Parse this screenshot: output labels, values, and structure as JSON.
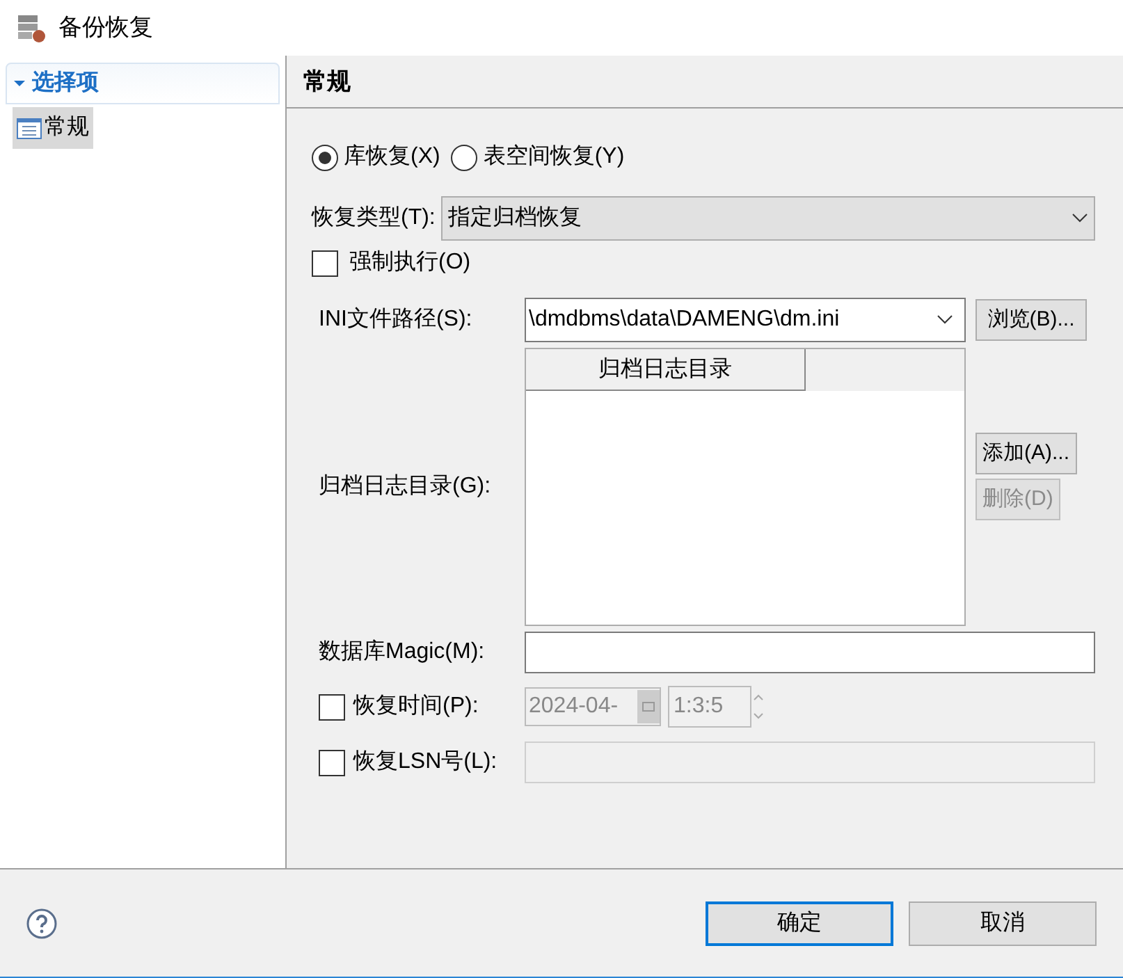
{
  "window": {
    "title": "备份恢复"
  },
  "sidebar": {
    "header": "选择项",
    "expanded": true,
    "items": [
      {
        "label": "常规",
        "selected": true
      }
    ]
  },
  "panel": {
    "title": "常规"
  },
  "restore_mode": [
    {
      "label": "库恢复(X)",
      "selected": true
    },
    {
      "label": "表空间恢复(Y)",
      "selected": false
    }
  ],
  "restore_type": {
    "label": "恢复类型(T):",
    "value": "指定归档恢复"
  },
  "force": {
    "label": "强制执行(O)",
    "checked": false
  },
  "ini_path": {
    "label": "INI文件路径(S):",
    "value": "\\dmdbms\\data\\DAMENG\\dm.ini",
    "button": "浏览(B)..."
  },
  "archive": {
    "label": "归档日志目录(G):",
    "columns": [
      "归档日志目录"
    ],
    "buttons": [
      {
        "label": "添加(A)...",
        "disabled": false
      },
      {
        "label": "删除(D)",
        "disabled": true
      }
    ]
  },
  "magic": {
    "label": "数据库Magic(M):"
  },
  "restore_time": {
    "label": "恢复时间(P):",
    "checked": false,
    "date": "2024-04-",
    "time": "1:3:5"
  },
  "restore_lsn": {
    "label": "恢复LSN号(L):",
    "checked": false
  },
  "footer": {
    "buttons": [
      {
        "label": "确定",
        "selected": true
      },
      {
        "label": "取消",
        "selected": false
      }
    ]
  }
}
